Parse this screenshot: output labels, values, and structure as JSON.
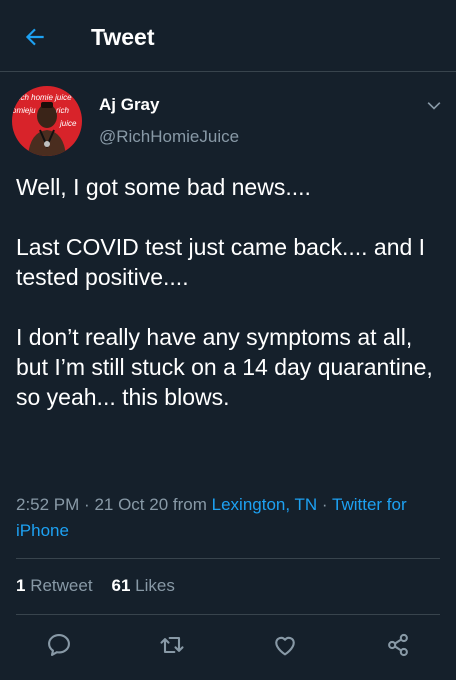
{
  "header": {
    "title": "Tweet",
    "back_icon": "arrow-left-icon"
  },
  "author": {
    "display_name": "Aj Gray",
    "handle": "@RichHomieJuice",
    "avatar_text": [
      "rich",
      "homie",
      "juice",
      "rich",
      "homie"
    ],
    "menu_icon": "chevron-down-icon"
  },
  "tweet": {
    "paragraphs": [
      "Well, I got some bad news....",
      "Last COVID test just came back.... and I tested positive....",
      "I don’t really have any symptoms at all, but I’m still stuck on a 14 day quarantine, so yeah... this blows."
    ]
  },
  "meta": {
    "time": "2:52 PM",
    "separator": "·",
    "date": "21 Oct 20",
    "from_label": "from",
    "location": "Lexington, TN",
    "source": "Twitter for iPhone"
  },
  "stats": {
    "retweets_count": "1",
    "retweets_label": "Retweet",
    "likes_count": "61",
    "likes_label": "Likes"
  },
  "actions": {
    "icons": [
      "reply-icon",
      "retweet-icon",
      "like-icon",
      "share-icon"
    ]
  },
  "colors": {
    "background": "#15202b",
    "accent": "#1da1f2",
    "secondary_text": "#8899a6",
    "divider": "#38444d"
  }
}
